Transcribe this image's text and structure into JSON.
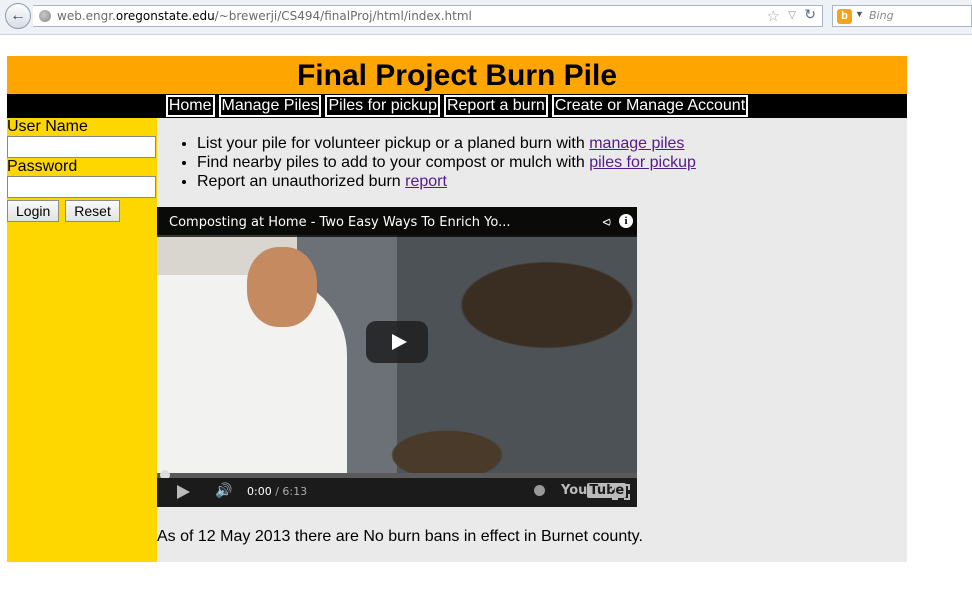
{
  "browser": {
    "url_prefix": "web.engr.",
    "url_host": "oregonstate.edu",
    "url_path": "/~brewerji/CS494/finalProj/html/index.html",
    "search_placeholder": "Bing",
    "search_engine_icon": "b"
  },
  "page": {
    "title": "Final Project Burn Pile",
    "nav": [
      "Home",
      "Manage Piles",
      "Piles for pickup",
      "Report a burn",
      "Create or Manage Account"
    ],
    "colors": {
      "header": "#ffa500",
      "nav": "#000000",
      "sidebar": "#ffd700",
      "content": "#eaeaea",
      "link": "#551a8b"
    }
  },
  "login": {
    "username_label": "User Name",
    "password_label": "Password",
    "username_value": "",
    "password_value": "",
    "login_button": "Login",
    "reset_button": "Reset"
  },
  "content": {
    "bullets": [
      {
        "text": "List your pile for volunteer pickup or a planed burn with ",
        "link": "manage piles"
      },
      {
        "text": "Find nearby piles to add to your compost or mulch with ",
        "link": "piles for pickup"
      },
      {
        "text": "Report an unauthorized burn ",
        "link": "report"
      }
    ],
    "video": {
      "title": "Composting at Home - Two Easy Ways To Enrich Yo...",
      "current_time": "0:00",
      "duration": "/ 6:13",
      "logo": "You",
      "logo_tube": "Tube"
    },
    "burn_ban": "As of 12 May 2013 there are No burn bans in effect in Burnet county."
  }
}
